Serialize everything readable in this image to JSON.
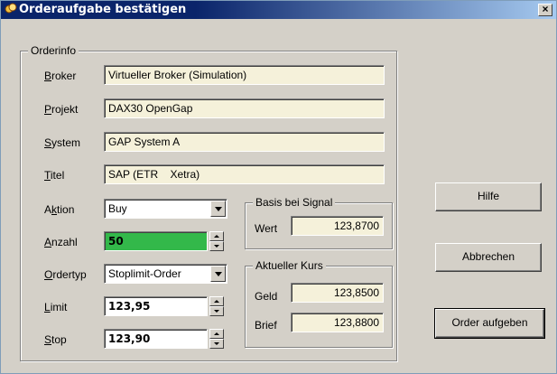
{
  "window": {
    "title": "Orderaufgabe bestätigen",
    "close_label": "×"
  },
  "orderinfo": {
    "legend": "Orderinfo",
    "broker": {
      "label": "Broker",
      "value": "Virtueller Broker (Simulation)"
    },
    "projekt": {
      "label": "Projekt",
      "value": "DAX30 OpenGap"
    },
    "system": {
      "label": "System",
      "value": "GAP System A"
    },
    "titel": {
      "label": "Titel",
      "value": "SAP (ETR    Xetra)"
    },
    "aktion": {
      "label": "Aktion",
      "value": "Buy"
    },
    "anzahl": {
      "label": "Anzahl",
      "value": "50"
    },
    "ordertyp": {
      "label": "Ordertyp",
      "value": "Stoplimit-Order"
    },
    "limit": {
      "label": "Limit",
      "value": "123,95"
    },
    "stop": {
      "label": "Stop",
      "value": "123,90"
    }
  },
  "basis": {
    "legend": "Basis bei Signal",
    "wert_label": "Wert",
    "wert_value": "123,8700"
  },
  "kurs": {
    "legend": "Aktueller Kurs",
    "geld_label": "Geld",
    "geld_value": "123,8500",
    "brief_label": "Brief",
    "brief_value": "123,8800"
  },
  "buttons": {
    "hilfe": "Hilfe",
    "abbrechen": "Abbrechen",
    "aufgeben": "Order aufgeben"
  },
  "colors": {
    "title_bar": "#0a246a",
    "field_bg": "#f5f1da",
    "anzahl_bg": "#33b84a"
  }
}
